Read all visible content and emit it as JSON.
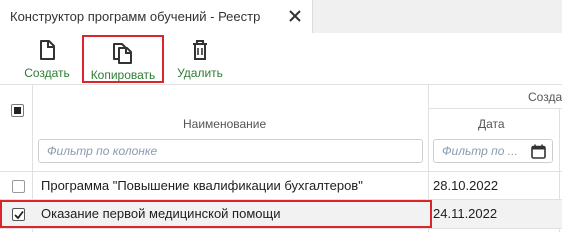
{
  "tab": {
    "title": "Конструктор программ обучений - Реестр"
  },
  "toolbar": {
    "create_label": "Создать",
    "copy_label": "Копировать",
    "delete_label": "Удалить"
  },
  "grid": {
    "group_header": "Созда",
    "columns": {
      "name": "Наименование",
      "date": "Дата"
    },
    "filters": {
      "name_placeholder": "Фильтр по колонке",
      "date_placeholder": "Фильтр по ..."
    },
    "rows": [
      {
        "name": "Программа \"Повышение квалификации бухгалтеров\"",
        "date": "28.10.2022",
        "checked": false
      },
      {
        "name": "Оказание первой медицинской помощи",
        "date": "24.11.2022",
        "checked": true
      }
    ]
  },
  "colors": {
    "accent_green": "#2e7d32",
    "highlight_red": "#d9252b",
    "selected_row": "#f2f2f2"
  },
  "icons": [
    "close-icon",
    "new-document-icon",
    "copy-icon",
    "trash-icon",
    "calendar-icon",
    "checkbox-icon",
    "checkmark-icon"
  ]
}
